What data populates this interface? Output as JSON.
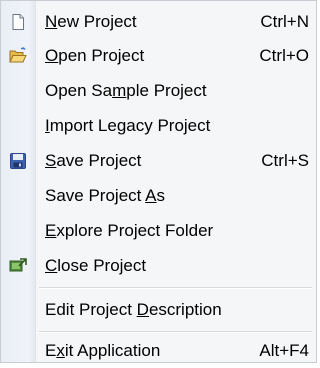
{
  "menu": {
    "items": [
      {
        "pre": "",
        "mn": "N",
        "post": "ew Project",
        "shortcut": "Ctrl+N",
        "icon": "new-document-icon"
      },
      {
        "pre": "",
        "mn": "O",
        "post": "pen Project",
        "shortcut": "Ctrl+O",
        "icon": "open-folder-icon"
      },
      {
        "pre": "Open Sa",
        "mn": "m",
        "post": "ple Project",
        "shortcut": ""
      },
      {
        "pre": "",
        "mn": "I",
        "post": "mport Legacy Project",
        "shortcut": ""
      },
      {
        "pre": "",
        "mn": "S",
        "post": "ave Project",
        "shortcut": "Ctrl+S",
        "icon": "save-floppy-icon"
      },
      {
        "pre": "Save Project ",
        "mn": "A",
        "post": "s",
        "shortcut": ""
      },
      {
        "pre": "",
        "mn": "E",
        "post": "xplore Project Folder",
        "shortcut": ""
      },
      {
        "pre": "",
        "mn": "C",
        "post": "lose Project",
        "shortcut": "",
        "icon": "close-project-icon"
      },
      {
        "pre": "Edit Project ",
        "mn": "D",
        "post": "escription",
        "shortcut": ""
      },
      {
        "pre": "E",
        "mn": "x",
        "post": "it Application",
        "shortcut": "Alt+F4"
      }
    ]
  }
}
